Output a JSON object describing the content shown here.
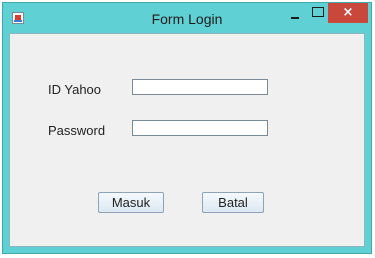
{
  "window": {
    "title": "Form Login",
    "close_glyph": "×",
    "icons": {
      "app": "java-app-icon",
      "minimize": "minimize-icon",
      "maximize": "maximize-icon",
      "close": "close-icon"
    },
    "colors": {
      "titlebar": "#5fd0d3",
      "close_button": "#c9473b",
      "panel": "#f0f0f0"
    }
  },
  "form": {
    "id_label": "ID Yahoo",
    "id_value": "",
    "password_label": "Password",
    "password_value": ""
  },
  "buttons": {
    "submit_label": "Masuk",
    "cancel_label": "Batal"
  }
}
